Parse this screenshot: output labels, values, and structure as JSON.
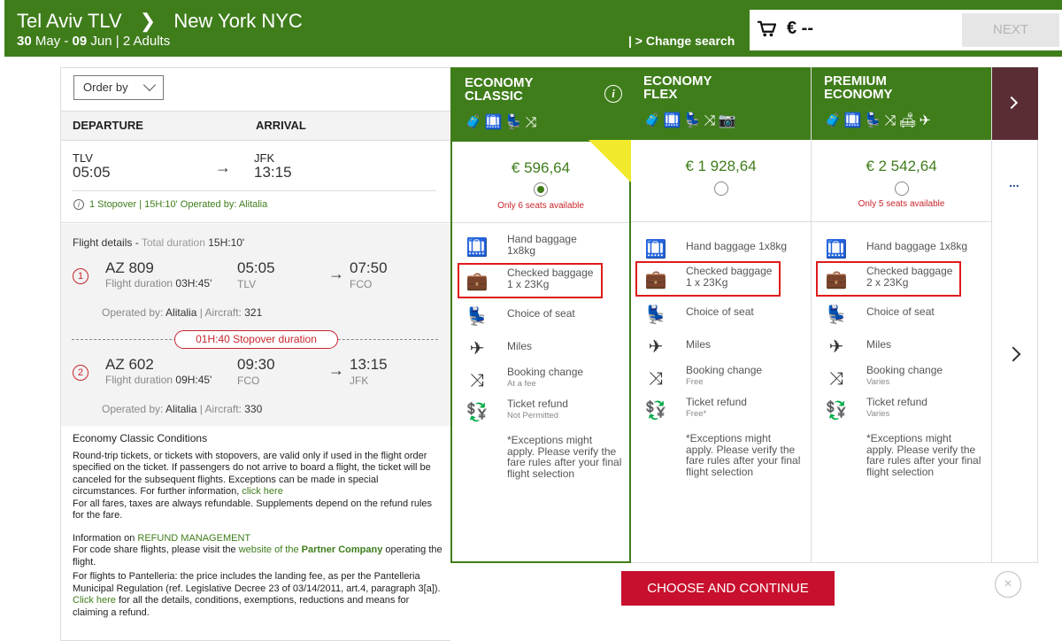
{
  "header": {
    "origin": "Tel Aviv TLV",
    "destination": "New York NYC",
    "date_from": "30",
    "month_from": "May",
    "date_to": "09",
    "month_to": "Jun",
    "passengers": "2 Adults",
    "change_search": "| > Change search",
    "cart_price": "€ --",
    "next_label": "NEXT"
  },
  "left": {
    "order_by": "Order by",
    "departure_label": "DEPARTURE",
    "arrival_label": "ARRIVAL",
    "summary": {
      "dep_code": "TLV",
      "dep_time": "05:05",
      "arr_code": "JFK",
      "arr_time": "13:15",
      "stopover_info": "1 Stopover | 15H:10' Operated by: Alitalia"
    },
    "details": {
      "title": "Flight details",
      "total_label": "Total duration",
      "total_value": "15H:10'",
      "segments": [
        {
          "num": "1",
          "flight": "AZ 809",
          "duration_label": "Flight duration",
          "duration": "03H:45'",
          "dep_time": "05:05",
          "dep_airport": "TLV",
          "arr_time": "07:50",
          "arr_airport": "FCO",
          "operated_label": "Operated by:",
          "operator": "Alitalia",
          "aircraft_label": "| Aircraft:",
          "aircraft": "321"
        },
        {
          "num": "2",
          "flight": "AZ 602",
          "duration_label": "Flight duration",
          "duration": "09H:45'",
          "dep_time": "09:30",
          "dep_airport": "FCO",
          "arr_time": "13:15",
          "arr_airport": "JFK",
          "operated_label": "Operated by:",
          "operator": "Alitalia",
          "aircraft_label": "| Aircraft:",
          "aircraft": "330"
        }
      ],
      "stopover_pill": "01H:40 Stopover duration"
    },
    "conditions": {
      "title": "Economy Classic Conditions",
      "p1": "Round-trip tickets, or tickets with stopovers, are valid only if used in the flight order specified on the ticket. If passengers do not arrive to board a flight, the ticket will be canceled for the subsequent flights. Exceptions can be made in special circumstances. For further information,",
      "p1_link": "click here",
      "p2": "For all fares, taxes are always refundable. Supplements depend on the refund rules for the fare.",
      "refund_prefix": "Information on",
      "refund_link": "REFUND MANAGEMENT",
      "p3_prefix": "For code share flights, please visit the",
      "p3_link": "website of the",
      "p3_bold": "Partner Company",
      "p3_suffix": "operating the flight.",
      "p4": "For flights to Pantelleria: the price includes the landing fee, as per the Pantelleria Municipal Regulation (ref. Legislative Decree 23 of 03/14/2011, art.4, paragraph 3[a]).",
      "p5_link": "Click here",
      "p5": "for all the details, conditions, exemptions, reductions and means for claiming a refund."
    }
  },
  "fares": [
    {
      "title": "ECONOMY\nCLASSIC",
      "icons": "🧳🛄💺⤨",
      "price": "€ 596,64",
      "seats": "Only 6 seats available",
      "hand": "Hand baggage",
      "hand_sub": "1x8kg",
      "checked": "Checked baggage",
      "checked_sub": "1 x 23Kg",
      "seat": "Choice of seat",
      "miles": "Miles",
      "change": "Booking change",
      "change_sub": "At a fee",
      "refund": "Ticket refund",
      "refund_sub": "Not Permitted",
      "exceptions": "*Exceptions might apply. Please verify the fare rules after your final flight selection"
    },
    {
      "title": "ECONOMY\nFLEX",
      "icons": "🧳🛄💺⤨📷",
      "price": "€ 1 928,64",
      "seats": "",
      "hand": "Hand baggage 1x8kg",
      "hand_sub": "",
      "checked": "Checked baggage",
      "checked_sub": "1 x 23Kg",
      "seat": "Choice of seat",
      "miles": "Miles",
      "change": "Booking change",
      "change_sub": "Free",
      "refund": "Ticket refund",
      "refund_sub": "Free*",
      "exceptions": "*Exceptions might apply. Please verify the fare rules after your final flight selection"
    },
    {
      "title": "PREMIUM\nECONOMY",
      "icons": "🧳🛄💺⤨🛋✈",
      "price": "€ 2 542,64",
      "seats": "Only 5 seats available",
      "hand": "Hand baggage 1x8kg",
      "hand_sub": "",
      "checked": "Checked baggage",
      "checked_sub": "2 x 23Kg",
      "seat": "Choice of seat",
      "miles": "Miles",
      "change": "Booking change",
      "change_sub": "Varies",
      "refund": "Ticket refund",
      "refund_sub": "Varies",
      "exceptions": "*Exceptions might apply. Please verify the fare rules after your final flight selection"
    }
  ],
  "more_dots": "...",
  "choose_label": "CHOOSE AND CONTINUE",
  "close_symbol": "×",
  "colors": {
    "brand_green": "#3f7d1b",
    "accent_red": "#c8102e",
    "dark_tab": "#5a2d35"
  }
}
